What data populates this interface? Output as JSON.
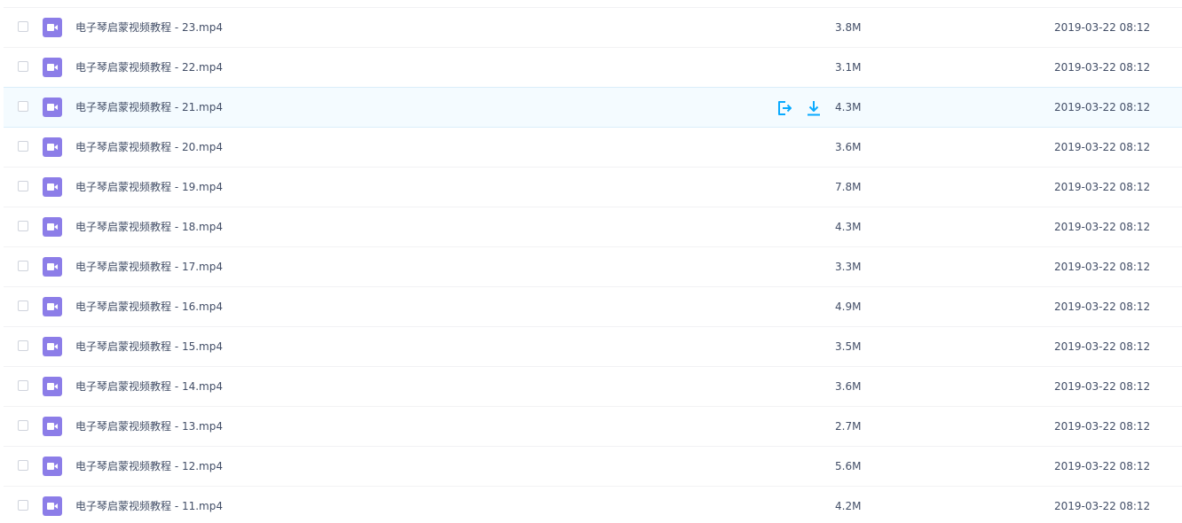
{
  "files": [
    {
      "name": "电子琴启蒙视频教程 - 23.mp4",
      "size": "3.8M",
      "date": "2019-03-22 08:12",
      "icon": "video-file-icon",
      "hovered": false
    },
    {
      "name": "电子琴启蒙视频教程 - 22.mp4",
      "size": "3.1M",
      "date": "2019-03-22 08:12",
      "icon": "video-file-icon",
      "hovered": false
    },
    {
      "name": "电子琴启蒙视频教程 - 21.mp4",
      "size": "4.3M",
      "date": "2019-03-22 08:12",
      "icon": "video-file-icon",
      "hovered": true
    },
    {
      "name": "电子琴启蒙视频教程 - 20.mp4",
      "size": "3.6M",
      "date": "2019-03-22 08:12",
      "icon": "video-file-icon",
      "hovered": false
    },
    {
      "name": "电子琴启蒙视频教程 - 19.mp4",
      "size": "7.8M",
      "date": "2019-03-22 08:12",
      "icon": "video-file-icon",
      "hovered": false
    },
    {
      "name": "电子琴启蒙视频教程 - 18.mp4",
      "size": "4.3M",
      "date": "2019-03-22 08:12",
      "icon": "video-file-icon",
      "hovered": false
    },
    {
      "name": "电子琴启蒙视频教程 - 17.mp4",
      "size": "3.3M",
      "date": "2019-03-22 08:12",
      "icon": "video-file-icon",
      "hovered": false
    },
    {
      "name": "电子琴启蒙视频教程 - 16.mp4",
      "size": "4.9M",
      "date": "2019-03-22 08:12",
      "icon": "video-file-icon",
      "hovered": false
    },
    {
      "name": "电子琴启蒙视频教程 - 15.mp4",
      "size": "3.5M",
      "date": "2019-03-22 08:12",
      "icon": "video-file-icon",
      "hovered": false
    },
    {
      "name": "电子琴启蒙视频教程 - 14.mp4",
      "size": "3.6M",
      "date": "2019-03-22 08:12",
      "icon": "video-file-icon",
      "hovered": false
    },
    {
      "name": "电子琴启蒙视频教程 - 13.mp4",
      "size": "2.7M",
      "date": "2019-03-22 08:12",
      "icon": "video-file-icon",
      "hovered": false
    },
    {
      "name": "电子琴启蒙视频教程 - 12.mp4",
      "size": "5.6M",
      "date": "2019-03-22 08:12",
      "icon": "video-file-icon",
      "hovered": false
    },
    {
      "name": "电子琴启蒙视频教程 - 11.mp4",
      "size": "4.2M",
      "date": "2019-03-22 08:12",
      "icon": "video-file-icon",
      "hovered": false
    }
  ],
  "hover_actions": [
    {
      "icon": "share-icon"
    },
    {
      "icon": "download-icon"
    }
  ],
  "colors": {
    "icon_background": "#8c7de8",
    "action_accent": "#09aaff",
    "hover_background": "#f4fbff",
    "text": "#424e67"
  }
}
